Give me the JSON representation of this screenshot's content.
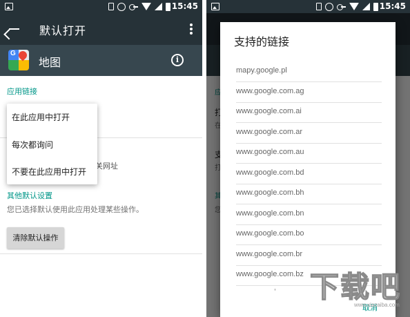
{
  "status_bar": {
    "time": "15:45",
    "icons": [
      "image-icon",
      "vibrate-icon",
      "alarm-icon",
      "key-icon",
      "wifi-icon",
      "signal-icon",
      "battery-icon"
    ]
  },
  "left": {
    "appbar_title": "默认打开",
    "app_name": "地图",
    "section_app_links": "应用链接",
    "popup": {
      "options": [
        "在此应用中打开",
        "每次都询问",
        "不要在此应用中打开"
      ]
    },
    "partial_text": "关网址",
    "section_other_defaults": "其他默认设置",
    "other_defaults_desc": "您已选择默认使用此应用处理某些操作。",
    "clear_button": "清除默认操作"
  },
  "right": {
    "dialog_title": "支持的链接",
    "links": [
      "mapy.google.pl",
      "www.google.com.ag",
      "www.google.com.ai",
      "www.google.com.ar",
      "www.google.com.au",
      "www.google.com.bd",
      "www.google.com.bh",
      "www.google.com.bn",
      "www.google.com.bo",
      "www.google.com.br",
      "www.google.com.bz"
    ],
    "more_indicator": "'",
    "cancel_button": "取消",
    "bg_fragments": [
      "应",
      "打",
      "在",
      "支",
      "打",
      "其",
      "您"
    ]
  },
  "watermark": {
    "text": "下载吧",
    "url": "www.xiazaiba.com"
  },
  "colors": {
    "appbar": "#263238",
    "app_row": "#37474f",
    "accent": "#009688"
  }
}
